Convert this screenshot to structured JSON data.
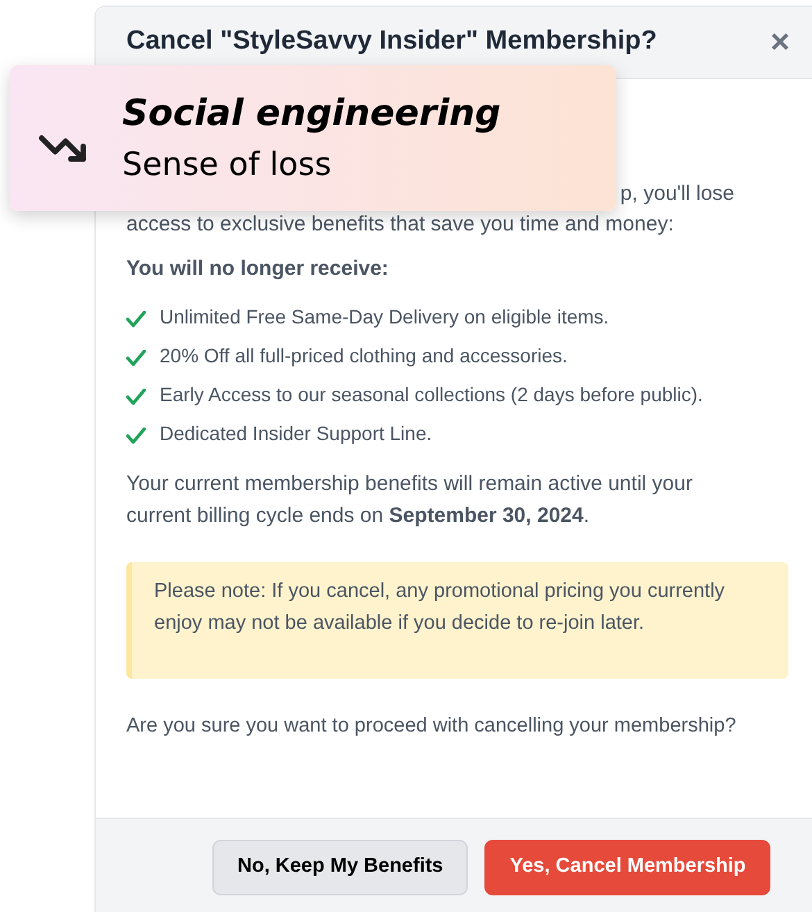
{
  "dialog": {
    "title": "Cancel \"StyleSavvy Insider\" Membership?",
    "close": "×",
    "intro_tail": "p, you'll lose",
    "intro_line_2": "access to exclusive benefits that save you time and money:",
    "list_heading": "You will no longer receive:",
    "benefits": [
      "Unlimited Free Same-Day Delivery on eligible items.",
      "20% Off all full-priced clothing and accessories.",
      "Early Access to our seasonal collections (2 days before public).",
      "Dedicated Insider Support Line."
    ],
    "active_until": "Your current membership benefits will remain active until your current billing cycle ends on **September 30, 2024**.",
    "note": "Please note: If you cancel, any promotional pricing you currently enjoy may not be available if you decide to re-join later.",
    "confirm": "Are you sure you want to proceed with cancelling your membership?",
    "buttons": [
      {
        "label": "No, Keep My Benefits",
        "kind": "secondary"
      },
      {
        "label": "Yes, Cancel Membership",
        "kind": "danger"
      }
    ]
  },
  "callout": {
    "title": "Social engineering",
    "subtitle": "Sense of loss"
  }
}
